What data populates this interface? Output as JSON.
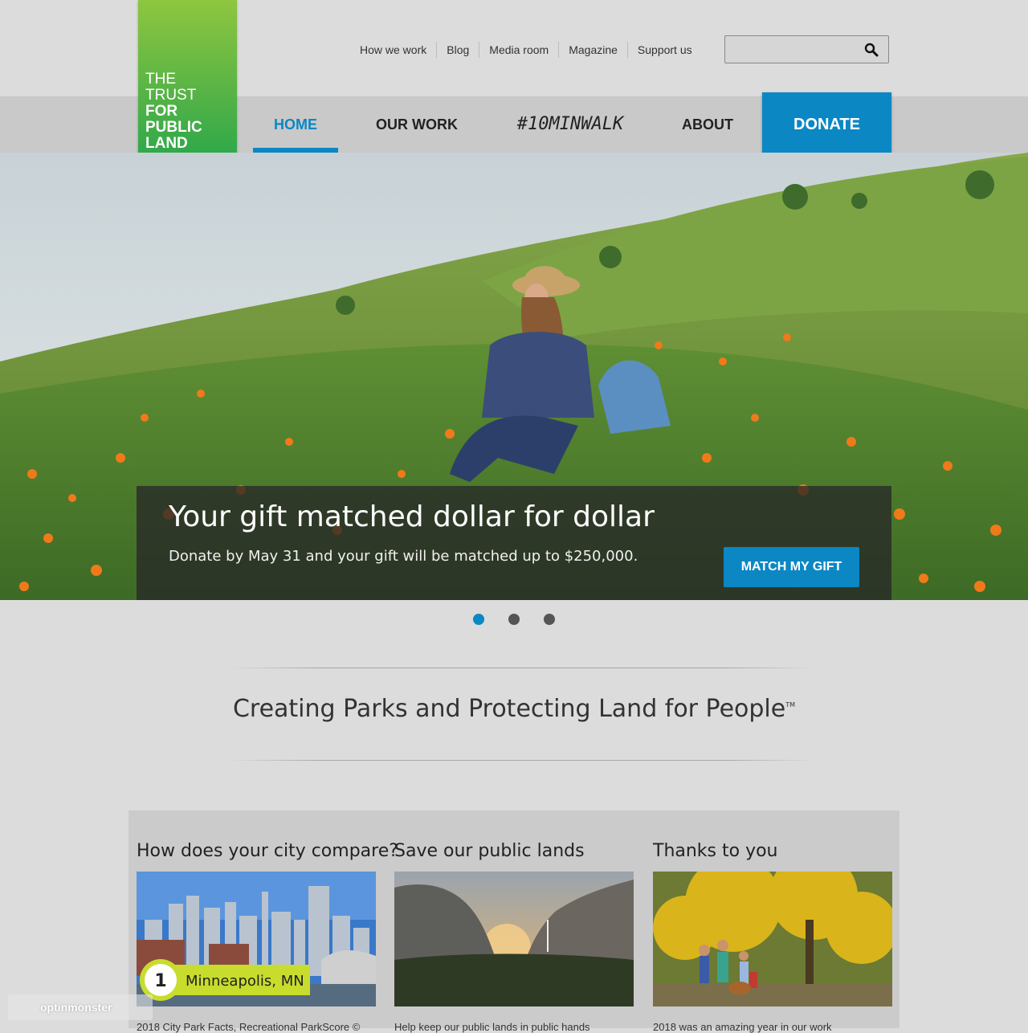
{
  "logo": {
    "line1": "THE",
    "line2": "TRUST",
    "line3": "FOR",
    "line4": "PUBLIC",
    "line5": "LAND"
  },
  "utility_nav": [
    "How we work",
    "Blog",
    "Media room",
    "Magazine",
    "Support us"
  ],
  "search": {
    "placeholder": "",
    "icon": "search-icon"
  },
  "main_nav": {
    "home": "HOME",
    "our_work": "OUR WORK",
    "ten_min": "#10MINWALK",
    "about": "ABOUT",
    "donate": "DONATE"
  },
  "hero": {
    "title": "Your gift matched dollar for dollar",
    "subtitle": "Donate by May 31 and your gift will be matched up to $250,000.",
    "button": "MATCH MY GIFT",
    "slides_total": 3,
    "active_slide": 1
  },
  "tagline": {
    "text": "Creating Parks and Protecting Land for People",
    "mark": "TM"
  },
  "cards": [
    {
      "title": "How does your city compare?",
      "badge_rank": "1",
      "badge_city": "Minneapolis, MN",
      "text": "2018 City Park Facts, Recreational ParkScore ©"
    },
    {
      "title": "Save our public lands",
      "text": "Help keep our public lands in public hands"
    },
    {
      "title": "Thanks to you",
      "text": "2018 was an amazing year in our work"
    }
  ],
  "optin": {
    "label": "optinmonster"
  },
  "colors": {
    "brand_blue": "#0b87c4",
    "logo_green": "#5bb545",
    "nav_bg": "#c9c9c9"
  }
}
